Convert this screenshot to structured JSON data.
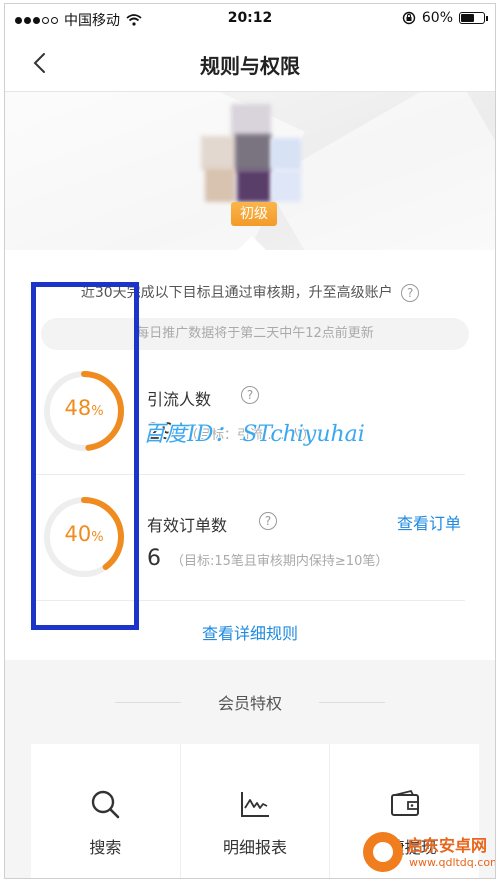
{
  "status_bar": {
    "carrier": "中国移动",
    "time": "20:12",
    "battery": "60%",
    "battery_level": 0.6
  },
  "nav": {
    "title": "规则与权限"
  },
  "profile": {
    "level_badge": "初级"
  },
  "rules": {
    "requirement_text": "近30天完成以下目标且通过审核期，升至高级账户",
    "update_notice": "每日推广数据将于第二天中午12点前更新"
  },
  "metrics": [
    {
      "title": "引流人数",
      "progress_percent": 48,
      "progress_number": "48",
      "value": "29",
      "target": "（目标：引流……人）"
    },
    {
      "title": "有效订单数",
      "progress_percent": 40,
      "progress_number": "40",
      "value": "6",
      "target": "（目标:15笔且审核期内保持≥10笔）",
      "link_label": "查看订单"
    }
  ],
  "percent_sign": "%",
  "help_glyph": "?",
  "detail_rules_label": "查看详细规则",
  "privileges": {
    "section_title": "会员特权",
    "items": [
      {
        "label": "搜索",
        "icon": "search-icon"
      },
      {
        "label": "明细报表",
        "icon": "line-chart-icon"
      },
      {
        "label": "快捷提现",
        "icon": "wallet-icon"
      }
    ]
  },
  "overlays": {
    "watermark": "百度ID： STchiyuhai",
    "corner_logo_title": "启东安卓网",
    "corner_logo_url": "www.qdltdq.com"
  },
  "colors": {
    "accent_orange": "#f08c1f",
    "link_blue": "#1f8be0",
    "highlight_blue": "#1c35c8",
    "ring_track": "#eeeeee"
  }
}
